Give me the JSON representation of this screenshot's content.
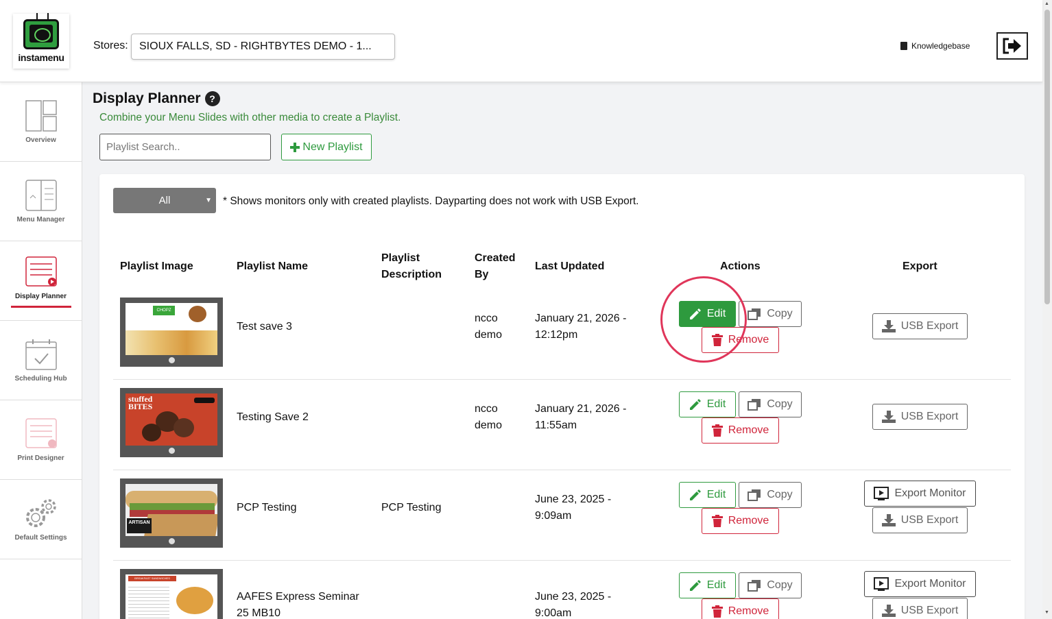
{
  "header": {
    "logo_text": "instamenu",
    "stores_label": "Stores:",
    "stores_value": "SIOUX FALLS, SD - RIGHTBYTES DEMO - 1...",
    "knowledgebase": "Knowledgebase"
  },
  "sidebar": {
    "items": [
      {
        "label": "Overview"
      },
      {
        "label": "Menu Manager"
      },
      {
        "label": "Display Planner"
      },
      {
        "label": "Scheduling Hub"
      },
      {
        "label": "Print Designer"
      },
      {
        "label": "Default Settings"
      }
    ]
  },
  "page": {
    "title": "Display Planner",
    "help": "?",
    "subtitle": "Combine your Menu Slides with other media to create a Playlist.",
    "search_placeholder": "Playlist Search..",
    "new_playlist": "New Playlist",
    "filter_value": "All",
    "note": "* Shows monitors only with created playlists. Dayparting does not work with USB Export."
  },
  "table": {
    "headers": {
      "image": "Playlist Image",
      "name": "Playlist Name",
      "desc_1": "Playlist",
      "desc_2": "Description",
      "created_1": "Created",
      "created_2": "By",
      "updated": "Last Updated",
      "actions": "Actions",
      "export": "Export"
    },
    "labels": {
      "edit": "Edit",
      "copy": "Copy",
      "remove": "Remove",
      "usb_export": "USB Export",
      "export_monitor": "Export Monitor"
    },
    "rows": [
      {
        "name": "Test save 3",
        "name_2": "",
        "desc": "",
        "created_1": "ncco",
        "created_2": "demo",
        "updated_1": "January 21, 2026 -",
        "updated_2": "12:12pm",
        "thumb_text": "CHOPZ"
      },
      {
        "name": "Testing Save 2",
        "name_2": "",
        "desc": "",
        "created_1": "ncco",
        "created_2": "demo",
        "updated_1": "January 21, 2026 -",
        "updated_2": "11:55am",
        "thumb_text": "stuffed BITES"
      },
      {
        "name": "PCP Testing",
        "name_2": "",
        "desc": "PCP Testing",
        "created_1": "",
        "created_2": "",
        "updated_1": "June 23, 2025 -",
        "updated_2": "9:09am",
        "thumb_text": "ARTISAN"
      },
      {
        "name": "AAFES Express Seminar",
        "name_2": "25 MB10",
        "desc": "",
        "created_1": "",
        "created_2": "",
        "updated_1": "June 23, 2025 -",
        "updated_2": "9:00am",
        "thumb_text": "BREAKFAST SANDWICHES"
      }
    ]
  },
  "colors": {
    "green": "#2e9a3e",
    "red": "#d0243a",
    "highlight": "#e0365a"
  }
}
